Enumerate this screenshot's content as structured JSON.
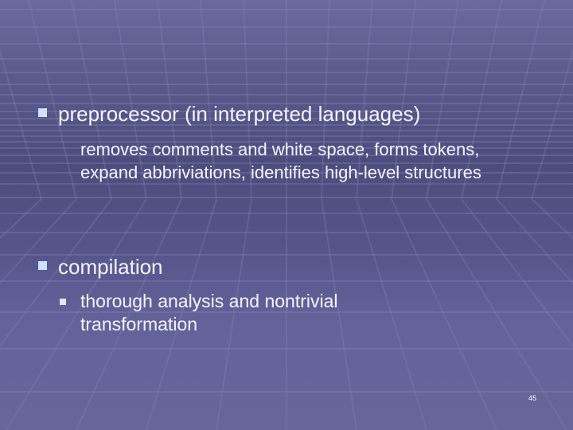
{
  "slide": {
    "bullets": [
      {
        "label": "preprocessor (in interpreted languages)",
        "body": "removes comments and white space, forms tokens, expand abbriviations, identifies high-level structures"
      },
      {
        "label": "compilation",
        "sub_bullets": [
          "thorough analysis and nontrivial transformation"
        ]
      }
    ],
    "page_number": "45"
  },
  "colors": {
    "bullet_primary": "#c8e4ff",
    "bullet_secondary": "#e6e6f2",
    "text": "#f4f4ff"
  }
}
